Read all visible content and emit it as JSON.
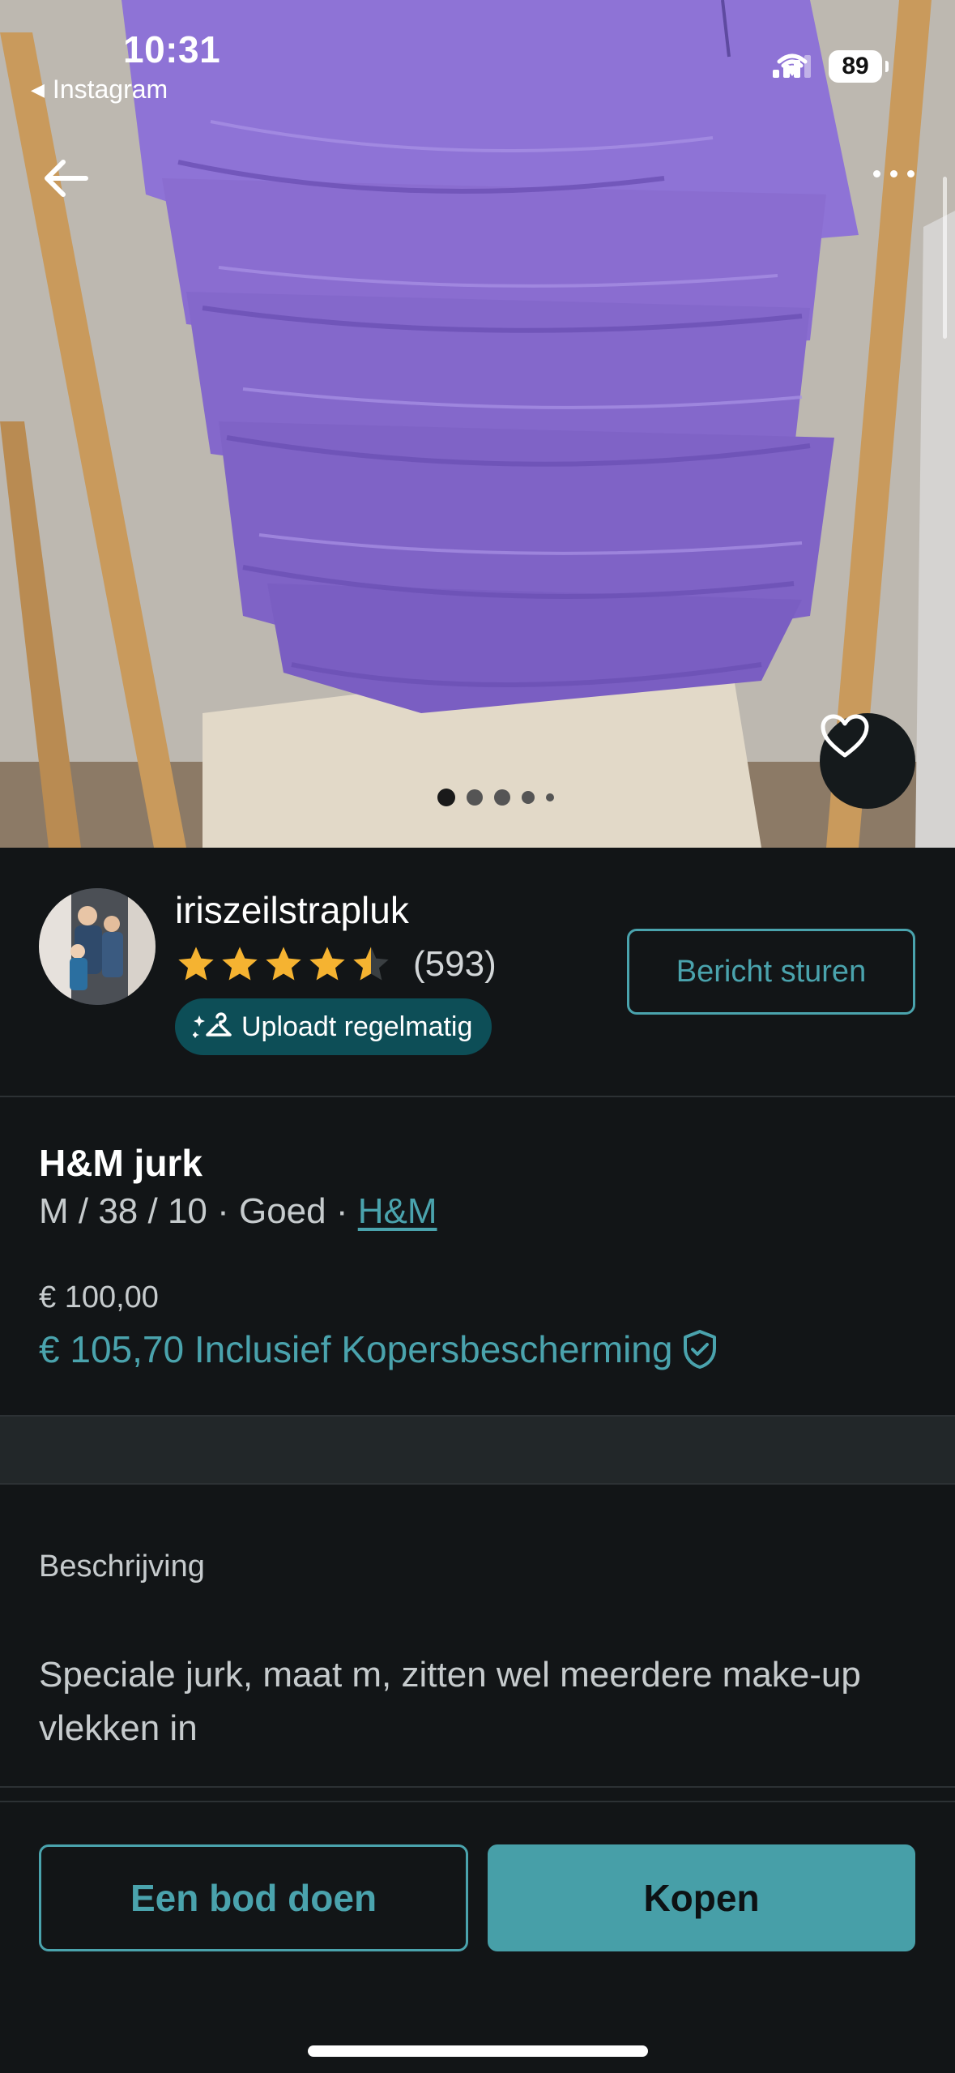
{
  "status_bar": {
    "time": "10:31",
    "back_app": "Instagram",
    "battery": "89"
  },
  "product_photo": {
    "dots_total": 5,
    "dots_active_index": 0
  },
  "seller": {
    "username": "iriszeilstrapluk",
    "rating": 4.5,
    "rating_max": 5,
    "review_count": "(593)",
    "badge": "Uploadt regelmatig",
    "message_button": "Bericht sturen"
  },
  "item": {
    "title": "H&M jurk",
    "meta": "M / 38 / 10 · Goed · ",
    "brand": "H&M",
    "price": "€ 100,00",
    "price_total": "€ 105,70 Inclusief Kopersbescherming"
  },
  "description": {
    "heading": "Beschrijving",
    "text": "Speciale jurk, maat m, zitten wel meerdere make-up vlekken in"
  },
  "actions": {
    "offer": "Een bod doen",
    "buy": "Kopen"
  },
  "colors": {
    "accent": "#4aa3ad",
    "background": "#121517",
    "star": "#f5b331",
    "badge_bg": "#0d4e57",
    "dress": "#8f72d3"
  }
}
